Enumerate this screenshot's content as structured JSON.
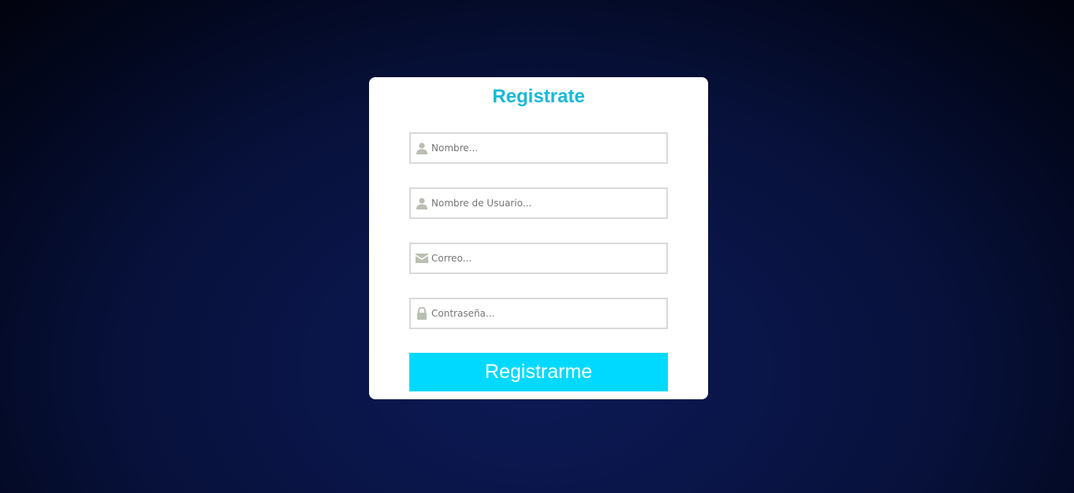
{
  "form": {
    "title": "Registrate",
    "fields": [
      {
        "name": "nombre",
        "icon": "user-icon",
        "placeholder": "Nombre...",
        "value": ""
      },
      {
        "name": "usuario",
        "icon": "user-icon",
        "placeholder": "Nombre de Usuario...",
        "value": ""
      },
      {
        "name": "correo",
        "icon": "envelope-icon",
        "placeholder": "Correo...",
        "value": ""
      },
      {
        "name": "contrasena",
        "icon": "lock-icon",
        "placeholder": "Contraseña...",
        "value": ""
      }
    ],
    "submit_label": "Registrarme"
  },
  "colors": {
    "title": "#1ab8d6",
    "button": "#00d9ff",
    "icon": "#b9bfb3",
    "field_border": "#d9d9d9",
    "card": "#ffffff",
    "background": "#0a1548"
  }
}
